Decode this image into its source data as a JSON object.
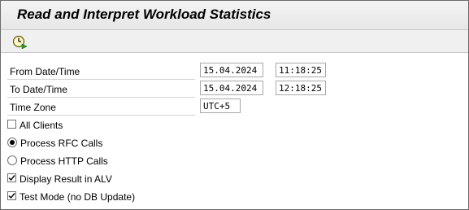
{
  "window": {
    "title": "Read and Interpret Workload Statistics"
  },
  "toolbar": {
    "execute_icon": "execute-clock-icon"
  },
  "form": {
    "from": {
      "label": "From Date/Time",
      "date": "15.04.2024",
      "time": "11:18:25"
    },
    "to": {
      "label": "To Date/Time",
      "date": "15.04.2024",
      "time": "12:18:25"
    },
    "timezone": {
      "label": "Time Zone",
      "value": "UTC+5"
    }
  },
  "options": {
    "all_clients": {
      "label": "All Clients",
      "checked": false
    },
    "rfc_calls": {
      "label": "Process RFC Calls",
      "selected": true
    },
    "http_calls": {
      "label": "Process HTTP Calls",
      "selected": false
    },
    "alv": {
      "label": "Display Result in ALV",
      "checked": true
    },
    "test_mode": {
      "label": "Test Mode (no DB Update)",
      "checked": true
    }
  }
}
